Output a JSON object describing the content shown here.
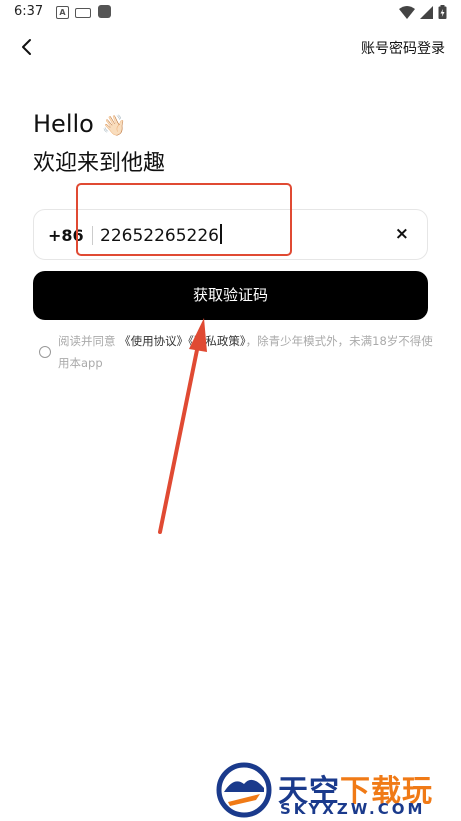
{
  "status_bar": {
    "time": "6:37",
    "a_icon_letter": "A"
  },
  "header": {
    "account_login": "账号密码登录"
  },
  "greeting": {
    "hello": "Hello",
    "wave_emoji": "👋🏻",
    "welcome": "欢迎来到他趣"
  },
  "phone": {
    "country_code": "+86",
    "value": "22652265226",
    "clear_symbol": "×"
  },
  "get_code_button": "获取验证码",
  "agreement": {
    "prefix": "阅读并同意 ",
    "user_agreement": "《使用协议》",
    "privacy_policy": "《隐私政策》",
    "suffix": "，除青少年模式外，未满18岁不得使用本app"
  },
  "watermark": {
    "cn_part1": "天空",
    "cn_part2": "下载玩",
    "en": "SKYXZW.COM"
  },
  "colors": {
    "annotation": "#e04a33",
    "button_bg": "#000000",
    "watermark_blue": "#1a3a8c",
    "watermark_orange": "#f07a16"
  }
}
